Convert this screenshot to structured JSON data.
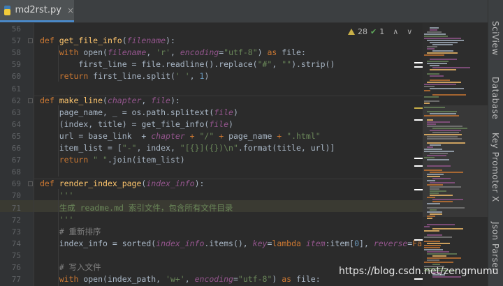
{
  "tab": {
    "filename": "md2rst.py",
    "close": "×"
  },
  "inspections": {
    "warnings": "28",
    "ok": "1",
    "up": "∧",
    "down": "∨"
  },
  "right_tools": [
    "SciView",
    "Database",
    "Key Promoter X",
    "Json Parser"
  ],
  "lines": [
    {
      "n": "56",
      "tokens": []
    },
    {
      "n": "57",
      "tokens": [
        [
          "kw",
          "def "
        ],
        [
          "fn",
          "get_file_info"
        ],
        [
          "",
          "("
        ],
        [
          "par",
          "filename"
        ],
        [
          "",
          "):"
        ]
      ]
    },
    {
      "n": "58",
      "tokens": [
        [
          "",
          "    "
        ],
        [
          "kw",
          "with "
        ],
        [
          "",
          "open("
        ],
        [
          "par",
          "filename"
        ],
        [
          "",
          ", "
        ],
        [
          "str",
          "'r'"
        ],
        [
          "",
          ", "
        ],
        [
          "par",
          "encoding"
        ],
        [
          "",
          "="
        ],
        [
          "str",
          "\"utf-8\""
        ],
        [
          "",
          ") "
        ],
        [
          "kw",
          "as "
        ],
        [
          "",
          "file:"
        ]
      ]
    },
    {
      "n": "59",
      "tokens": [
        [
          "",
          "        first_line = file.readline().replace("
        ],
        [
          "str",
          "\"#\""
        ],
        [
          "",
          ", "
        ],
        [
          "str",
          "\"\""
        ],
        [
          "",
          ").strip()"
        ]
      ]
    },
    {
      "n": "60",
      "tokens": [
        [
          "",
          "    "
        ],
        [
          "kw",
          "return "
        ],
        [
          "",
          "first_line.split("
        ],
        [
          "str",
          "' '"
        ],
        [
          "",
          ", "
        ],
        [
          "num",
          "1"
        ],
        [
          "",
          ")"
        ]
      ]
    },
    {
      "n": "61",
      "tokens": []
    },
    {
      "n": "62",
      "tokens": [
        [
          "kw",
          "def "
        ],
        [
          "fn",
          "make_line"
        ],
        [
          "",
          "("
        ],
        [
          "par",
          "chapter"
        ],
        [
          "",
          ", "
        ],
        [
          "par",
          "file"
        ],
        [
          "",
          "):"
        ]
      ]
    },
    {
      "n": "63",
      "tokens": [
        [
          "",
          "    page_name, _ = os.path.splitext("
        ],
        [
          "par",
          "file"
        ],
        [
          "",
          ")"
        ]
      ]
    },
    {
      "n": "64",
      "tokens": [
        [
          "",
          "    (index, title) = get_file_info("
        ],
        [
          "par",
          "file"
        ],
        [
          "",
          ")"
        ]
      ]
    },
    {
      "n": "65",
      "tokens": [
        [
          "",
          "    url = base_link  + "
        ],
        [
          "par",
          "chapter"
        ],
        [
          "kw",
          " + "
        ],
        [
          "str",
          "\"/\""
        ],
        [
          "kw",
          " + "
        ],
        [
          "",
          "page_name"
        ],
        [
          "kw",
          " + "
        ],
        [
          "str",
          "\".html\""
        ]
      ]
    },
    {
      "n": "66",
      "tokens": [
        [
          "",
          "    item_list = ["
        ],
        [
          "str",
          "\"-\""
        ],
        [
          "",
          ", index, "
        ],
        [
          "str",
          "\"[{}]({})\\n\""
        ],
        [
          "",
          ".format(title, url)]"
        ]
      ]
    },
    {
      "n": "67",
      "tokens": [
        [
          "",
          "    "
        ],
        [
          "kw",
          "return "
        ],
        [
          "str",
          "\" \""
        ],
        [
          "",
          ".join(item_list)"
        ]
      ]
    },
    {
      "n": "68",
      "tokens": []
    },
    {
      "n": "69",
      "tokens": [
        [
          "kw",
          "def "
        ],
        [
          "fn",
          "render_index_page"
        ],
        [
          "",
          "("
        ],
        [
          "par",
          "index_info"
        ],
        [
          "",
          "):"
        ]
      ]
    },
    {
      "n": "70",
      "tokens": [
        [
          "",
          "    "
        ],
        [
          "str",
          "'''"
        ]
      ]
    },
    {
      "n": "71",
      "tokens": [
        [
          "",
          "    "
        ],
        [
          "str",
          "生成 readme.md 索引文件，包含所有文件目录"
        ]
      ]
    },
    {
      "n": "72",
      "tokens": [
        [
          "",
          "    "
        ],
        [
          "str",
          "'''"
        ]
      ]
    },
    {
      "n": "73",
      "tokens": [
        [
          "",
          "    "
        ],
        [
          "cmt",
          "# 重新排序"
        ]
      ]
    },
    {
      "n": "74",
      "tokens": [
        [
          "",
          "    index_info = sorted("
        ],
        [
          "par",
          "index_info"
        ],
        [
          "",
          ".items(), "
        ],
        [
          "par",
          "key"
        ],
        [
          "",
          "="
        ],
        [
          "kw",
          "lambda "
        ],
        [
          "par",
          "item"
        ],
        [
          "",
          ":item["
        ],
        [
          "num",
          "0"
        ],
        [
          "",
          "], "
        ],
        [
          "par",
          "reverse"
        ],
        [
          "",
          "="
        ],
        [
          "kw",
          "False"
        ],
        [
          "",
          ")"
        ]
      ]
    },
    {
      "n": "75",
      "tokens": []
    },
    {
      "n": "76",
      "tokens": [
        [
          "",
          "    "
        ],
        [
          "cmt",
          "# 写入文件"
        ]
      ]
    },
    {
      "n": "77",
      "tokens": [
        [
          "",
          "    "
        ],
        [
          "kw",
          "with "
        ],
        [
          "",
          "open(index_path, "
        ],
        [
          "str",
          "'w+'"
        ],
        [
          "",
          ", "
        ],
        [
          "par",
          "encoding"
        ],
        [
          "",
          "="
        ],
        [
          "str",
          "\"utf-8\""
        ],
        [
          "",
          ") "
        ],
        [
          "kw",
          "as "
        ],
        [
          "",
          "file:"
        ]
      ]
    }
  ],
  "watermark": "https://blog.csdn.net/zengmumu"
}
